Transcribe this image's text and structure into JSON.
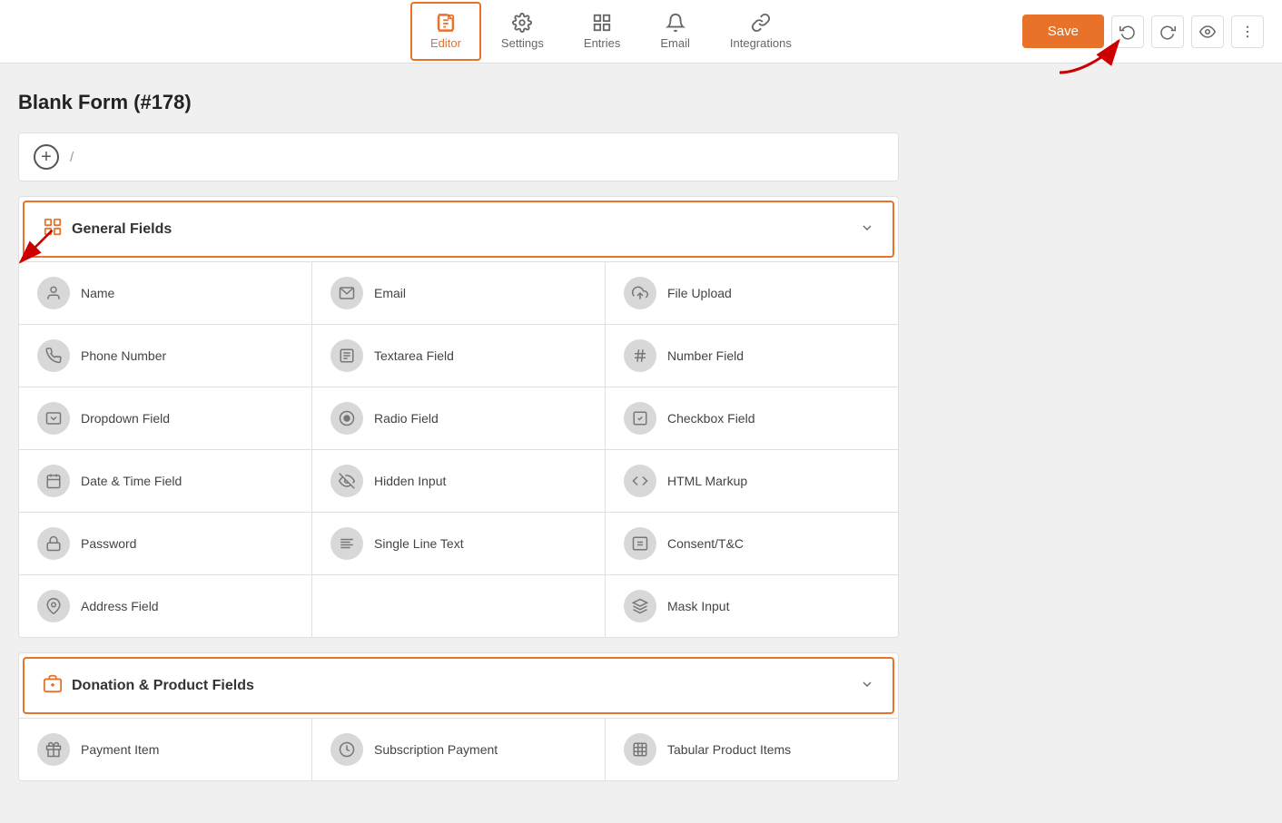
{
  "nav": {
    "items": [
      {
        "id": "editor",
        "label": "Editor",
        "active": true
      },
      {
        "id": "settings",
        "label": "Settings",
        "active": false
      },
      {
        "id": "entries",
        "label": "Entries",
        "active": false
      },
      {
        "id": "email",
        "label": "Email",
        "active": false
      },
      {
        "id": "integrations",
        "label": "Integrations",
        "active": false
      }
    ],
    "save_label": "Save"
  },
  "page": {
    "title": "Blank Form (#178)"
  },
  "add_row": {
    "plus": "+",
    "slash": "/"
  },
  "sections": [
    {
      "id": "general",
      "title": "General Fields",
      "outlined": true,
      "fields": [
        {
          "id": "name",
          "label": "Name",
          "icon": "person"
        },
        {
          "id": "email",
          "label": "Email",
          "icon": "email"
        },
        {
          "id": "file-upload",
          "label": "File Upload",
          "icon": "upload"
        },
        {
          "id": "phone-number",
          "label": "Phone Number",
          "icon": "phone"
        },
        {
          "id": "textarea-field",
          "label": "Textarea Field",
          "icon": "textarea"
        },
        {
          "id": "number-field",
          "label": "Number Field",
          "icon": "hash"
        },
        {
          "id": "dropdown-field",
          "label": "Dropdown Field",
          "icon": "dropdown"
        },
        {
          "id": "radio-field",
          "label": "Radio Field",
          "icon": "radio"
        },
        {
          "id": "checkbox-field",
          "label": "Checkbox Field",
          "icon": "checkbox"
        },
        {
          "id": "date-time-field",
          "label": "Date & Time Field",
          "icon": "calendar"
        },
        {
          "id": "hidden-input",
          "label": "Hidden Input",
          "icon": "hidden"
        },
        {
          "id": "html-markup",
          "label": "HTML Markup",
          "icon": "html"
        },
        {
          "id": "password",
          "label": "Password",
          "icon": "lock"
        },
        {
          "id": "single-line-text",
          "label": "Single Line Text",
          "icon": "text"
        },
        {
          "id": "consent-tc",
          "label": "Consent/T&C",
          "icon": "consent"
        },
        {
          "id": "address-field",
          "label": "Address Field",
          "icon": "location"
        },
        {
          "id": "spacer1",
          "label": "",
          "icon": ""
        },
        {
          "id": "mask-input",
          "label": "Mask Input",
          "icon": "mask"
        }
      ]
    },
    {
      "id": "donation",
      "title": "Donation & Product Fields",
      "outlined": true,
      "fields": [
        {
          "id": "payment-item",
          "label": "Payment Item",
          "icon": "gift"
        },
        {
          "id": "subscription-payment",
          "label": "Subscription Payment",
          "icon": "subscription"
        },
        {
          "id": "tabular-product-items",
          "label": "Tabular Product Items",
          "icon": "table"
        }
      ]
    }
  ]
}
